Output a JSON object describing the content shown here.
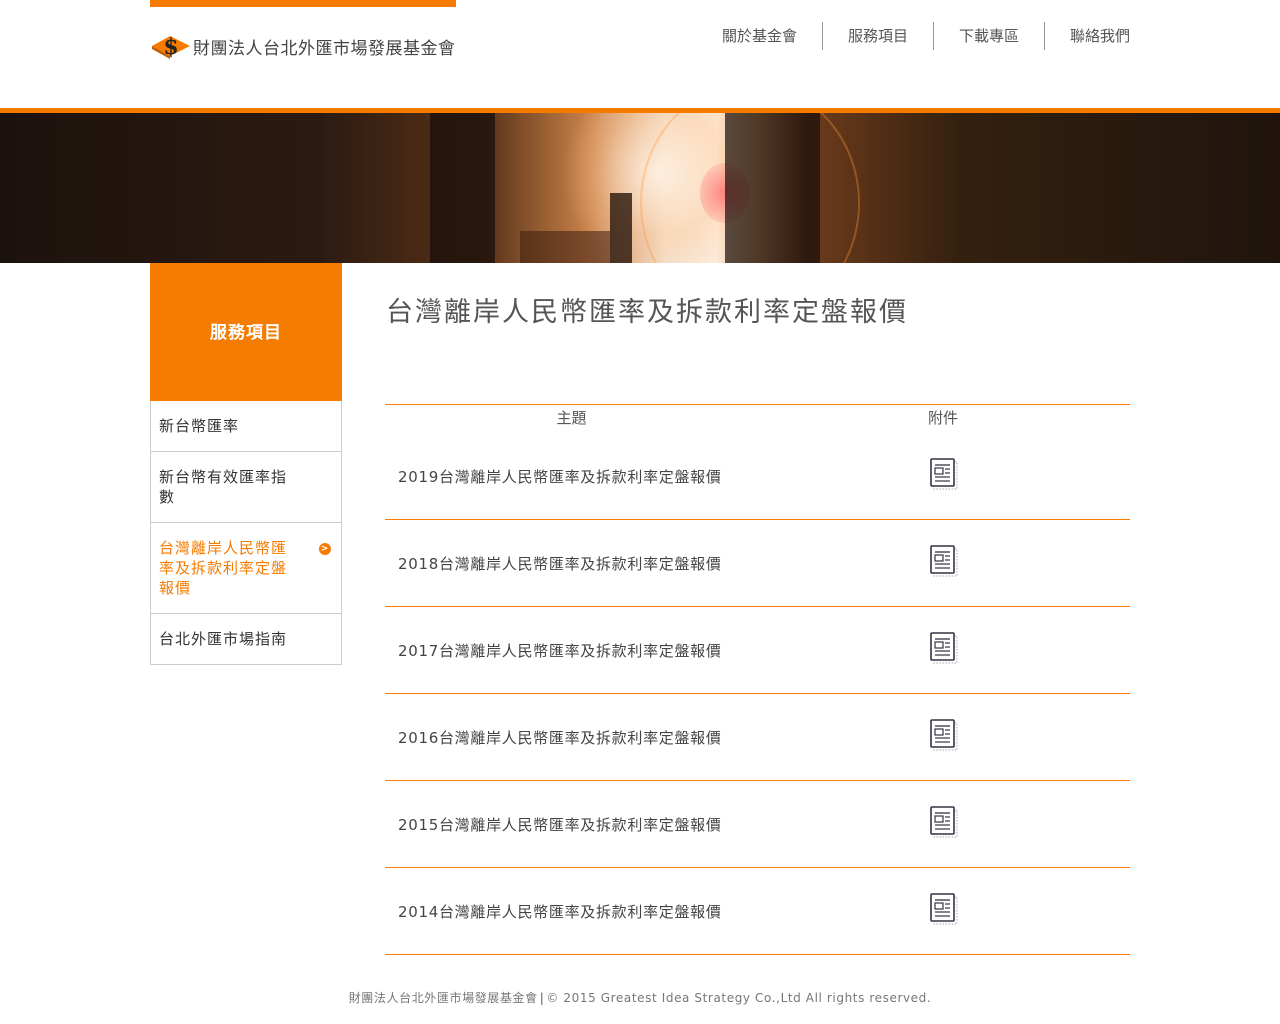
{
  "brand": {
    "name": "財團法人台北外匯市場發展基金會",
    "accent_color": "#f57c00"
  },
  "nav": {
    "items": [
      {
        "label": "關於基金會"
      },
      {
        "label": "服務項目"
      },
      {
        "label": "下載專區"
      },
      {
        "label": "聯絡我們"
      }
    ]
  },
  "sidebar": {
    "title": "服務項目",
    "items": [
      {
        "label": "新台幣匯率",
        "active": false
      },
      {
        "label": "新台幣有效匯率指數",
        "active": false
      },
      {
        "label": "台灣離岸人民幣匯率及拆款利率定盤報價",
        "active": true,
        "indicator": ">"
      },
      {
        "label": "台北外匯市場指南",
        "active": false
      }
    ]
  },
  "main": {
    "title": "台灣離岸人民幣匯率及拆款利率定盤報價",
    "table": {
      "headers": {
        "subject": "主題",
        "attachment": "附件"
      },
      "rows": [
        {
          "subject": "2019台灣離岸人民幣匯率及拆款利率定盤報價",
          "attachment_icon": "document-icon"
        },
        {
          "subject": "2018台灣離岸人民幣匯率及拆款利率定盤報價",
          "attachment_icon": "document-icon"
        },
        {
          "subject": "2017台灣離岸人民幣匯率及拆款利率定盤報價",
          "attachment_icon": "document-icon"
        },
        {
          "subject": "2016台灣離岸人民幣匯率及拆款利率定盤報價",
          "attachment_icon": "document-icon"
        },
        {
          "subject": "2015台灣離岸人民幣匯率及拆款利率定盤報價",
          "attachment_icon": "document-icon"
        },
        {
          "subject": "2014台灣離岸人民幣匯率及拆款利率定盤報價",
          "attachment_icon": "document-icon"
        }
      ]
    }
  },
  "footer": {
    "org": "財團法人台北外匯市場發展基金會",
    "separator": "|",
    "copyright": "© 2015 Greatest Idea Strategy Co.,Ltd All rights reserved."
  }
}
